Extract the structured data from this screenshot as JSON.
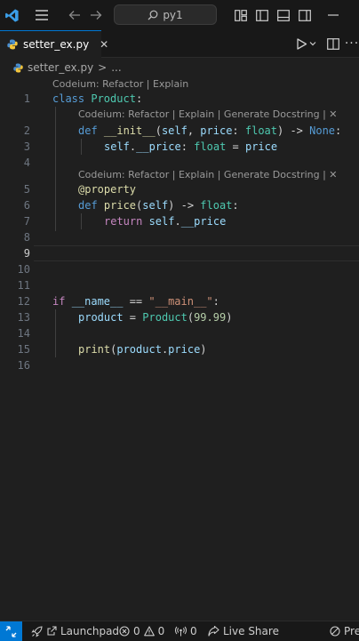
{
  "titlebar": {
    "search_text": "py1"
  },
  "tab": {
    "file_name": "setter_ex.py",
    "close_glyph": "✕"
  },
  "breadcrumb": {
    "file": "setter_ex.py",
    "separator": ">",
    "more": "..."
  },
  "editor": {
    "active_line": 9,
    "line_numbers": [
      "1",
      "2",
      "3",
      "4",
      "5",
      "6",
      "7",
      "8",
      "9",
      "10",
      "11",
      "12",
      "13",
      "14",
      "15",
      "16"
    ],
    "codelens": {
      "top": "Codeium: Refactor | Explain",
      "init": "Codeium: Refactor | Explain | Generate Docstring | ✕",
      "property": "Codeium: Refactor | Explain | Generate Docstring | ✕"
    },
    "lines": [
      [
        [
          "kw",
          "class "
        ],
        [
          "cls",
          "Product"
        ],
        [
          "txt",
          ":"
        ]
      ],
      [
        [
          "kw",
          "def "
        ],
        [
          "fn",
          "__init__"
        ],
        [
          "txt",
          "("
        ],
        [
          "var",
          "self"
        ],
        [
          "txt",
          ", "
        ],
        [
          "var",
          "price"
        ],
        [
          "txt",
          ": "
        ],
        [
          "cls",
          "float"
        ],
        [
          "txt",
          ") -> "
        ],
        [
          "kw",
          "None"
        ],
        [
          "txt",
          ":"
        ]
      ],
      [
        [
          "var",
          "self"
        ],
        [
          "txt",
          "."
        ],
        [
          "var",
          "__price"
        ],
        [
          "txt",
          ": "
        ],
        [
          "cls",
          "float"
        ],
        [
          "txt",
          " = "
        ],
        [
          "var",
          "price"
        ]
      ],
      [],
      [
        [
          "fn",
          "@property"
        ]
      ],
      [
        [
          "kw",
          "def "
        ],
        [
          "fn",
          "price"
        ],
        [
          "txt",
          "("
        ],
        [
          "var",
          "self"
        ],
        [
          "txt",
          ") -> "
        ],
        [
          "cls",
          "float"
        ],
        [
          "txt",
          ":"
        ]
      ],
      [
        [
          "ctrl",
          "return "
        ],
        [
          "var",
          "self"
        ],
        [
          "txt",
          "."
        ],
        [
          "var",
          "__price"
        ]
      ],
      [],
      [],
      [],
      [],
      [
        [
          "ctrl",
          "if "
        ],
        [
          "var",
          "__name__"
        ],
        [
          "txt",
          " == "
        ],
        [
          "str",
          "\"__main__\""
        ],
        [
          "txt",
          ":"
        ]
      ],
      [
        [
          "var",
          "product"
        ],
        [
          "txt",
          " = "
        ],
        [
          "cls",
          "Product"
        ],
        [
          "txt",
          "("
        ],
        [
          "num",
          "99.99"
        ],
        [
          "txt",
          ")"
        ]
      ],
      [],
      [
        [
          "fn",
          "print"
        ],
        [
          "txt",
          "("
        ],
        [
          "var",
          "product"
        ],
        [
          "txt",
          "."
        ],
        [
          "var",
          "price"
        ],
        [
          "txt",
          ")"
        ]
      ],
      []
    ]
  },
  "statusbar": {
    "launchpad": "Launchpad",
    "errors": "0",
    "warnings": "0",
    "ports": "0",
    "live_share": "Live Share",
    "prettier": "Pre"
  }
}
